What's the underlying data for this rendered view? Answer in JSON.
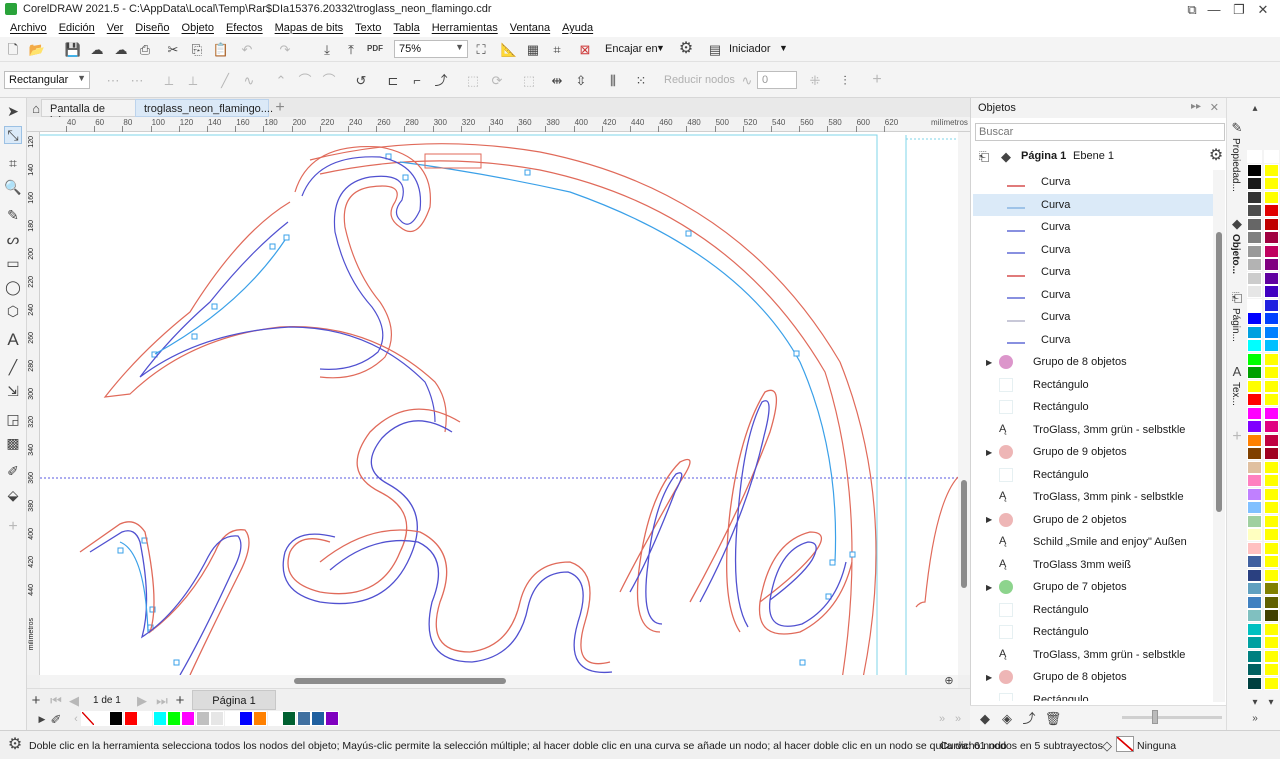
{
  "window": {
    "title": "CorelDRAW 2021.5 - C:\\AppData\\Local\\Temp\\Rar$DIa15376.20332\\troglass_neon_flamingo.cdr"
  },
  "menu": [
    "Archivo",
    "Edición",
    "Ver",
    "Diseño",
    "Objeto",
    "Efectos",
    "Mapas de bits",
    "Texto",
    "Tabla",
    "Herramientas",
    "Ventana",
    "Ayuda"
  ],
  "toolbar": {
    "zoom": "75%",
    "snap_label": "Encajar en",
    "launch_label": "Iniciador",
    "pdf_label": "PDF"
  },
  "property_bar": {
    "selection_mode": "Rectangular",
    "reduce_nodes": "Reducir nodos",
    "curve_smoothness": "0"
  },
  "tabs": [
    {
      "label": "Pantalla de inic..."
    },
    {
      "label": "troglass_neon_flamingo...."
    }
  ],
  "ruler": {
    "units": "milímetros",
    "ticks": [
      "40",
      "60",
      "80",
      "100",
      "120",
      "140",
      "160",
      "180",
      "200",
      "220",
      "240",
      "260",
      "280",
      "300",
      "320",
      "340",
      "360",
      "380",
      "400",
      "420",
      "440",
      "460",
      "480",
      "500",
      "520",
      "540",
      "560",
      "580",
      "600",
      "620"
    ],
    "vticks": [
      "120",
      "140",
      "160",
      "180",
      "200",
      "220",
      "240",
      "260",
      "280",
      "300",
      "320",
      "340",
      "360",
      "380",
      "400",
      "420",
      "440"
    ],
    "vunits": "milímetros"
  },
  "pages": {
    "counter": "1 de 1",
    "page_tab": "Página 1"
  },
  "objects_panel": {
    "title": "Objetos",
    "search_placeholder": "Buscar",
    "page": "Página 1",
    "layer": "Ebene 1",
    "items": [
      {
        "label": "Curva",
        "type": "curve",
        "thumb": "#e07a7a"
      },
      {
        "label": "Curva",
        "type": "curve",
        "thumb": "#9ec3e8",
        "selected": true
      },
      {
        "label": "Curva",
        "type": "curve",
        "thumb": "#8890e0"
      },
      {
        "label": "Curva",
        "type": "curve",
        "thumb": "#8890e0"
      },
      {
        "label": "Curva",
        "type": "curve",
        "thumb": "#e07a7a"
      },
      {
        "label": "Curva",
        "type": "curve",
        "thumb": "#8890e0"
      },
      {
        "label": "Curva",
        "type": "curve",
        "thumb": "#c8c8d8"
      },
      {
        "label": "Curva",
        "type": "curve",
        "thumb": "#8890e0"
      },
      {
        "label": "Grupo de 8 objetos",
        "type": "group",
        "thumb": "#c040a0",
        "expand": true
      },
      {
        "label": "Rectángulo",
        "type": "rect"
      },
      {
        "label": "Rectángulo",
        "type": "rect"
      },
      {
        "label": "TroGlass, 3mm grün - selbstkle",
        "type": "text"
      },
      {
        "label": "Grupo de 9 objetos",
        "type": "group",
        "thumb": "#e07a7a",
        "expand": true
      },
      {
        "label": "Rectángulo",
        "type": "rect"
      },
      {
        "label": "TroGlass, 3mm pink - selbstkle",
        "type": "text"
      },
      {
        "label": "Grupo de 2 objetos",
        "type": "group",
        "thumb": "#e07a7a",
        "expand": true
      },
      {
        "label": "Schild „Smile and enjoy\" Außen",
        "type": "text"
      },
      {
        "label": "TroGlass 3mm weiß",
        "type": "text"
      },
      {
        "label": "Grupo de 7 objetos",
        "type": "group",
        "thumb": "#30b030",
        "expand": true
      },
      {
        "label": "Rectángulo",
        "type": "rect"
      },
      {
        "label": "Rectángulo",
        "type": "rect"
      },
      {
        "label": "TroGlass, 3mm grün - selbstkle",
        "type": "text"
      },
      {
        "label": "Grupo de 8 objetos",
        "type": "group",
        "thumb": "#e07a7a",
        "expand": true
      },
      {
        "label": "Rectángulo",
        "type": "rect"
      }
    ]
  },
  "side_tabs": [
    "Propiedad...",
    "Objeto...",
    "Págin...",
    "Tex..."
  ],
  "palette_colors": [
    "#ffffff",
    "#000000",
    "#1a1a1a",
    "#333333",
    "#4d4d4d",
    "#666666",
    "#808080",
    "#999999",
    "#b3b3b3",
    "#cccccc",
    "#e6e6e6",
    "#ffffff",
    "#0000ff",
    "#00a0e0",
    "#00ffff",
    "#00ff00",
    "#00a000",
    "#ffff00",
    "#ff0000",
    "#ff00ff",
    "#8000ff",
    "#ff8000",
    "#804000",
    "#e0c0a0",
    "#ff80c0",
    "#c080ff",
    "#80c0ff",
    "#a0d0a0",
    "#ffffc0",
    "#ffc0c0",
    "#4060a0",
    "#2a4080",
    "#60a0c0",
    "#4080c0",
    "#80c0c0",
    "#00c0c0",
    "#00a0a0",
    "#008080",
    "#006060",
    "#004040"
  ],
  "palette_colors2": [
    "#ffffff",
    "#ffff00",
    "#ffff00",
    "#ffff00",
    "#e00000",
    "#c00000",
    "#a00040",
    "#c00060",
    "#800080",
    "#6000a0",
    "#4000c0",
    "#2020e0",
    "#0040ff",
    "#0080ff",
    "#00c0ff",
    "#ffff00",
    "#ffff00",
    "#ffff00",
    "#ffff00",
    "#ff00ff",
    "#e00080",
    "#c00040",
    "#a00020",
    "#ffff00",
    "#ffff00",
    "#ffff00",
    "#ffff00",
    "#ffff00",
    "#ffff00",
    "#ffff00",
    "#ffff00",
    "#ffff00",
    "#808000",
    "#606000",
    "#404000",
    "#ffff00",
    "#ffff00",
    "#ffff00",
    "#ffff00",
    "#ffff00"
  ],
  "doc_palette": [
    "#ffffff",
    "#000000",
    "#ff0000",
    "#ffffff",
    "#00ffff",
    "#00ff00",
    "#ff00ff",
    "#c0c0c0",
    "#e6e6e6",
    "#ffffff",
    "#0000ff",
    "#ff8000",
    "#ffffff",
    "#006030",
    "#4070a0",
    "#2060a0",
    "#8000c0"
  ],
  "status": {
    "hint": "Doble clic en la herramienta selecciona todos los nodos del objeto; Mayús-clic permite la selección múltiple; al hacer doble clic en una curva se añade un nodo; al hacer doble clic en un nodo se quita dicho nodo",
    "info": "Curva: 61 nodos en 5 subtrayectos",
    "fill": "Ninguna"
  }
}
